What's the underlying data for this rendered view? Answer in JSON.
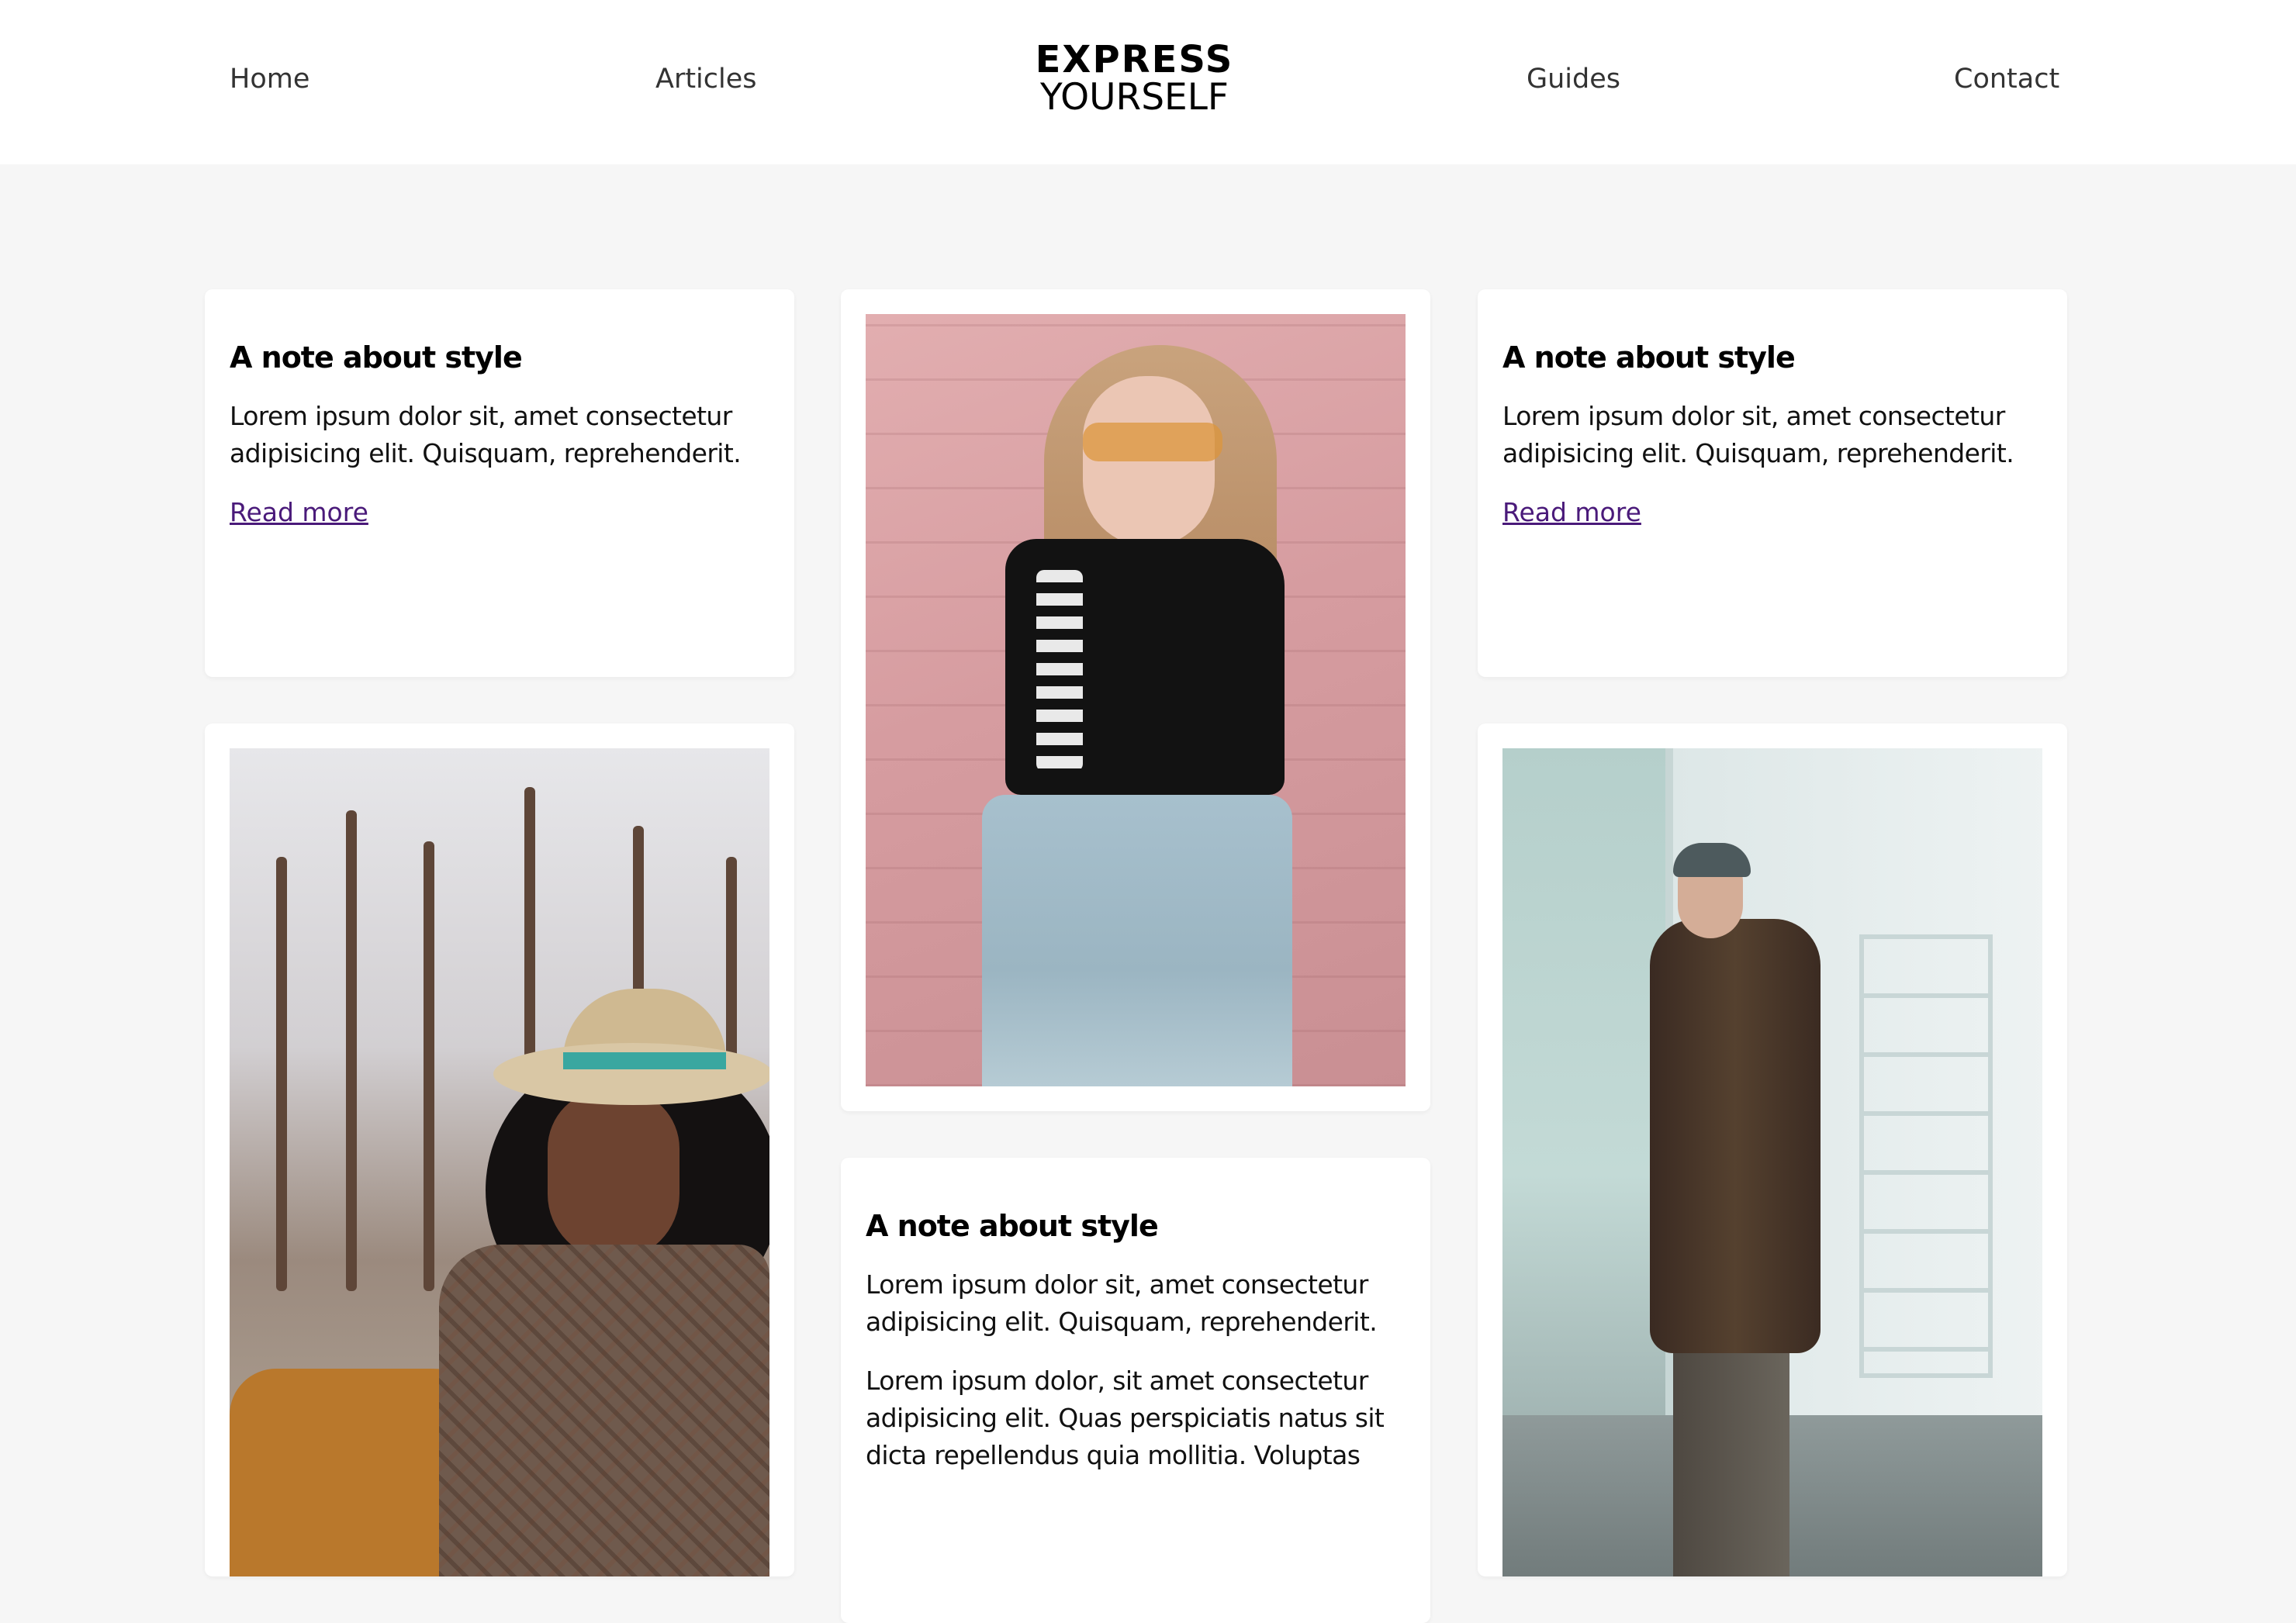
{
  "header": {
    "nav": {
      "home": "Home",
      "articles": "Articles",
      "guides": "Guides",
      "contact": "Contact"
    },
    "logo": {
      "line1": "EXPRESS",
      "line2": "YOURSELF"
    }
  },
  "cards": {
    "card1": {
      "title": "A note about style",
      "text": "Lorem ipsum dolor sit, amet consectetur adipisicing elit. Quisquam, reprehenderit.",
      "link": "Read more"
    },
    "card3": {
      "title": "A note about style",
      "text": "Lorem ipsum dolor sit, amet consectetur adipisicing elit. Quisquam, reprehenderit.",
      "link": "Read more"
    },
    "card5": {
      "title": "A note about style",
      "text1": "Lorem ipsum dolor sit, amet consectetur adipisicing elit. Quisquam, reprehenderit.",
      "text2": "Lorem ipsum dolor, sit amet consectetur adipisicing elit. Quas perspiciatis natus sit dicta repellendus quia mollitia. Voluptas"
    }
  },
  "colors": {
    "page_background": "#f6f6f6",
    "card_background": "#ffffff",
    "link": "#4a1a7a",
    "text": "#111111"
  },
  "images": {
    "photo1": "portrait-woman-pink-wall",
    "photo2": "portrait-woman-hat-trees",
    "photo3": "portrait-man-long-coat-street"
  }
}
